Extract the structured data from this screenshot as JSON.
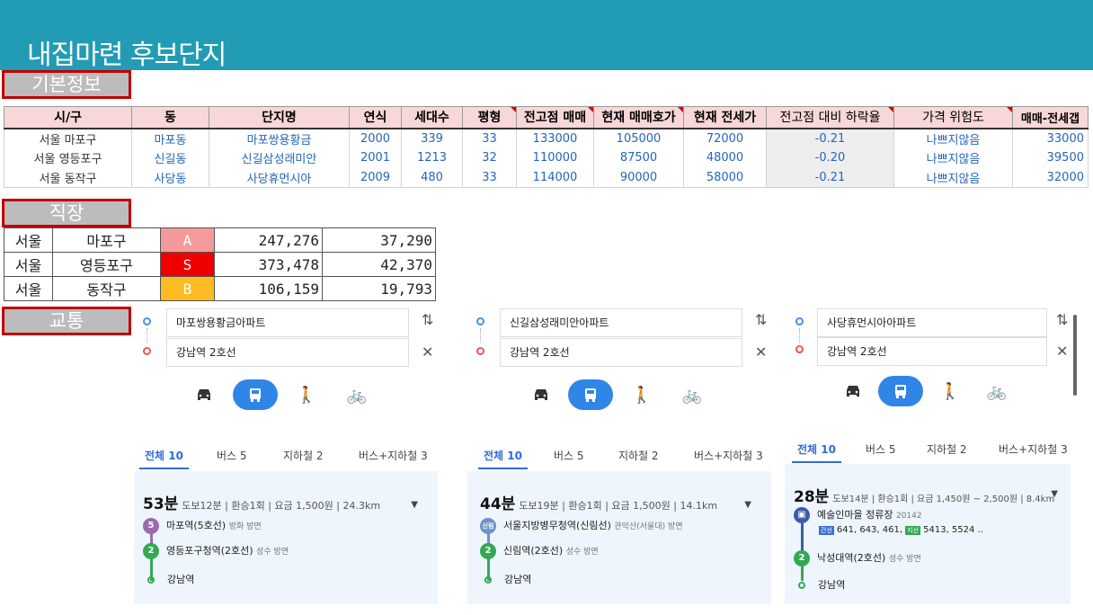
{
  "title": "내집마련 후보단지",
  "sections": {
    "basic": "기본정보",
    "work": "직장",
    "transit": "교통"
  },
  "table1": {
    "headers": [
      "시/구",
      "동",
      "단지명",
      "연식",
      "세대수",
      "평형",
      "전고점 매매",
      "현재 매매호가",
      "현재 전세가",
      "전고점 대비 하락율",
      "가격 위험도",
      "매매-전세갭"
    ],
    "rows": [
      [
        "서울 마포구",
        "마포동",
        "마포쌍용황금",
        "2000",
        "339",
        "33",
        "133000",
        "105000",
        "72000",
        "-0.21",
        "나쁘지않음",
        "33000"
      ],
      [
        "서울 영등포구",
        "신길동",
        "신길삼성래미안",
        "2001",
        "1213",
        "32",
        "110000",
        "87500",
        "48000",
        "-0.20",
        "나쁘지않음",
        "39500"
      ],
      [
        "서울 동작구",
        "사당동",
        "사당휴먼시아",
        "2009",
        "480",
        "33",
        "114000",
        "90000",
        "58000",
        "-0.21",
        "나쁘지않음",
        "32000"
      ]
    ]
  },
  "table2": {
    "rows": [
      [
        "서울",
        "마포구",
        "A",
        "247,276",
        "37,290"
      ],
      [
        "서울",
        "영등포구",
        "S",
        "373,478",
        "42,370"
      ],
      [
        "서울",
        "동작구",
        "B",
        "106,159",
        "19,793"
      ]
    ]
  },
  "colors": {
    "A": "#f59a9a",
    "S": "#ee0000",
    "B": "#ffbb22",
    "banner": "#219cb4"
  },
  "panels": [
    {
      "from": "마포쌍용황금아파트",
      "to": "강남역 2호선",
      "tabs": [
        "전체 10",
        "버스 5",
        "지하철 2",
        "버스+지하철 3"
      ],
      "time": "53분",
      "meta": "도보12분 | 환승1회 | 요금 1,500원 | 24.3km",
      "stops": [
        {
          "badge": "5",
          "name": "마포역(5호선)",
          "sub": "방화 방면"
        },
        {
          "badge": "2",
          "name": "영등포구청역(2호선)",
          "sub": "성수 방면"
        },
        {
          "badge": "",
          "name": "강남역",
          "sub": ""
        }
      ]
    },
    {
      "from": "신길삼성래미안아파트",
      "to": "강남역 2호선",
      "tabs": [
        "전체 10",
        "버스 5",
        "지하철 2",
        "버스+지하철 3"
      ],
      "time": "44분",
      "meta": "도보19분 | 환승1회 | 요금 1,500원 | 14.1km",
      "stops": [
        {
          "badge": "신림",
          "name": "서울지방병무청역(신림선)",
          "sub": "관악산(서울대) 방면"
        },
        {
          "badge": "2",
          "name": "신림역(2호선)",
          "sub": "성수 방면"
        },
        {
          "badge": "",
          "name": "강남역",
          "sub": ""
        }
      ]
    },
    {
      "from": "사당휴먼시아아파트",
      "to": "강남역 2호선",
      "tabs": [
        "전체 10",
        "버스 5",
        "지하철 2",
        "버스+지하철 3"
      ],
      "time": "28분",
      "meta": "도보14분 | 환승1회 | 요금 1,450원 ~ 2,500원 | 8.4km",
      "stops": [
        {
          "badge": "bus",
          "name": "예술인마을 정류장",
          "sub": "20142"
        },
        {
          "badge": "2",
          "name": "낙성대역(2호선)",
          "sub": "성수 방면"
        },
        {
          "badge": "",
          "name": "강남역",
          "sub": ""
        }
      ],
      "buslines": {
        "trunk_label": "간선",
        "trunk": "641, 643, 461,",
        "branch_label": "지선",
        "branch": "5413, 5524 .."
      }
    }
  ]
}
